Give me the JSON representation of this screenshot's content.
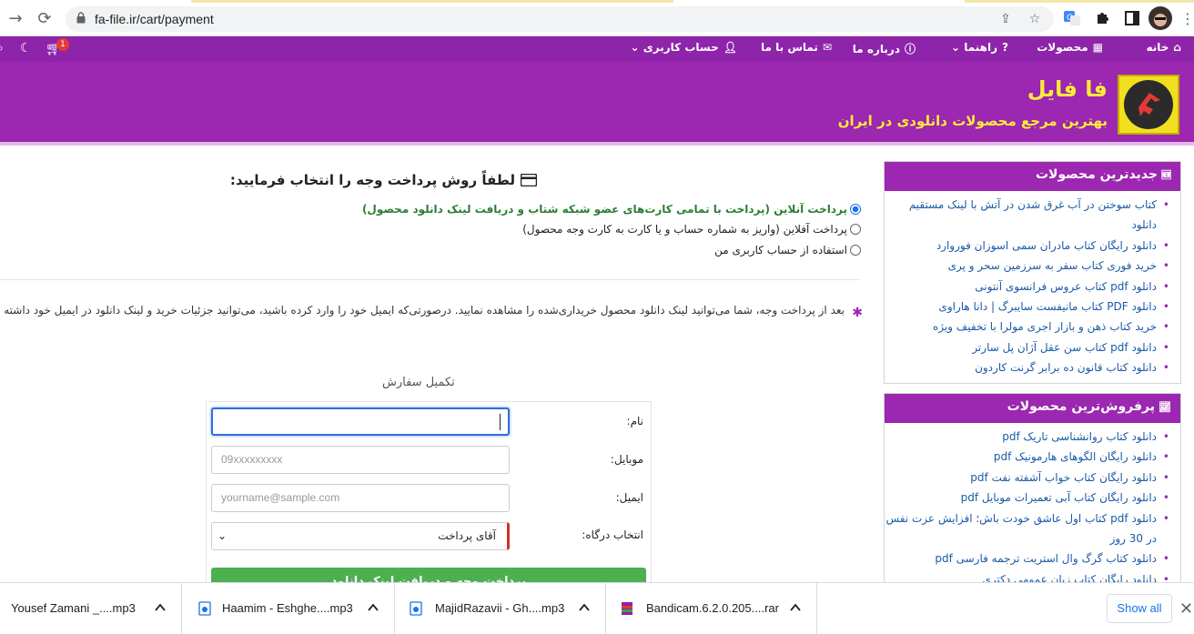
{
  "browser": {
    "url": "fa-file.ir/cart/payment"
  },
  "site_nav": {
    "home": "خانه",
    "products": "محصولات",
    "help": "راهنما",
    "about": "درباره ما",
    "contact": "تماس با ما",
    "account": "حساب کاربری",
    "cart_badge": "1"
  },
  "banner": {
    "site_name": "فا فایل",
    "tagline": "بهترین مرجع محصولات دانلودی در ایران"
  },
  "sidebar": {
    "newest_title": "جدیدترین محصولات",
    "newest": [
      "کتاب سوختن در آب غرق شدن در آتش با لینک مستقیم دانلود",
      "دانلود رایگان کتاب مادران سمی اسوزان فوروارد",
      "خرید فوری کتاب سفر به سرزمین سحر و پری",
      "دانلود pdf کتاب عروس فرانسوی آنتونی",
      "دانلود PDF کتاب مانیفست سایبرگ | دانا هاراوی",
      "خرید کتاب ذهن و بازار اجری مولرا با تخفیف ویژه",
      "دانلود pdf کتاب سن عقل آژان پل سارتر",
      "دانلود کتاب قانون ده برابر گرنت کاردون"
    ],
    "best_title": "پرفروش‌ترین محصولات",
    "best": [
      "دانلود کتاب روانشناسی تاریک pdf",
      "دانلود رایگان الگوهای هارمونیک pdf",
      "دانلود رایگان کتاب خواب آشفته نفت pdf",
      "دانلود رایگان کتاب آبی تعمیرات موبایل pdf",
      "دانلود pdf کتاب اول عاشق خودت باش؛ افزایش عزت نفس در 30 روز",
      "دانلود کتاب گرگ وال استریت ترجمه فارسی pdf",
      "دانلود رایگان کتاب زبان عمومی دکتری"
    ]
  },
  "payment": {
    "title": "لطفاً روش پرداخت وجه را انتخاب فرمایید:",
    "options": [
      "پرداخت آنلاین (پرداخت با تمامی کارت‌های عضو شبکه شتاب و دریافت لینک دانلود محصول)",
      "پرداخت آفلاین (واریز به شماره حساب و یا کارت به کارت وجه محصول)",
      "استفاده از حساب کاربری من"
    ],
    "note": "بعد از پرداخت وجه، شما می‌توانید لینک دانلود محصول خریداری‌شده را مشاهده نمایید. درصورتی‌که ایمیل خود را وارد کرده باشید، می‌توانید جزئیات خرید و لینک دانلود در ایمیل خود داشته باشید."
  },
  "order": {
    "title": "تکمیل سفارش",
    "name_label": "نام:",
    "mobile_label": "موبایل:",
    "mobile_placeholder": "09xxxxxxxxx",
    "email_label": "ایمیل:",
    "email_placeholder": "yourname@sample.com",
    "gateway_label": "انتخاب درگاه:",
    "gateway_value": "آقای پرداخت",
    "submit": "پرداخت وجه و دریافت لینک دانلود"
  },
  "downloads": {
    "items": [
      "Yousef Zamani _....mp3",
      "Haamim - Eshghe....mp3",
      "MajidRazavii - Gh....mp3",
      "Bandicam.6.2.0.205....rar"
    ],
    "show_all": "Show all"
  },
  "colors": {
    "site_purple": "#9c27b0",
    "nav_purple": "#8e24aa",
    "accent_yellow": "#ffeb3b",
    "submit_green": "#4caf50"
  }
}
